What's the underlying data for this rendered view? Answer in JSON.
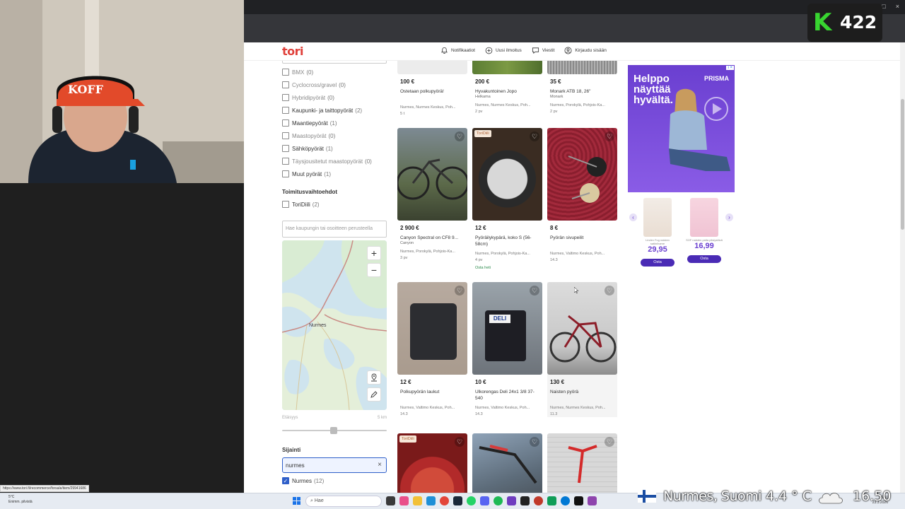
{
  "browser": {
    "window_controls": [
      "–",
      "□",
      "×"
    ]
  },
  "site": {
    "logo": "tori",
    "nav": [
      {
        "label": "Notifikaatiot",
        "icon": "bell-icon"
      },
      {
        "label": "Uusi ilmoitus",
        "icon": "plus-circle-icon"
      },
      {
        "label": "Viestit",
        "icon": "chat-icon"
      },
      {
        "label": "Kirjaudu sisään",
        "icon": "user-icon"
      }
    ]
  },
  "filters": {
    "categories": [
      {
        "label": "BMX",
        "count": "(0)",
        "disabled": true
      },
      {
        "label": "Cyclocross/gravel",
        "count": "(0)",
        "disabled": true
      },
      {
        "label": "Hybridipyörät",
        "count": "(0)",
        "disabled": true
      },
      {
        "label": "Kaupunki- ja taittopyörät",
        "count": "(2)",
        "disabled": false
      },
      {
        "label": "Maantiepyörät",
        "count": "(1)",
        "disabled": false
      },
      {
        "label": "Maastopyörät",
        "count": "(0)",
        "disabled": true
      },
      {
        "label": "Sähköpyörät",
        "count": "(1)",
        "disabled": false
      },
      {
        "label": "Täysjousitetut maastopyörät",
        "count": "(0)",
        "disabled": true
      },
      {
        "label": "Muut pyörät",
        "count": "(1)",
        "disabled": false
      }
    ],
    "delivery_title": "Toimitusvaihtoehdot",
    "delivery": {
      "label": "ToriDiili",
      "count": "(2)"
    },
    "address_placeholder": "Hae kaupungin tai osoitteen perusteella",
    "map_label": "Nurmes",
    "zoom_in": "+",
    "zoom_out": "−",
    "distance_label": "Etäisyys",
    "distance_value": "5 km",
    "distance_fraction": 0.5,
    "location_title": "Sijainti",
    "location_value": "nurmes",
    "location_clear": "×",
    "location_option": {
      "label": "Nurmes",
      "count": "(12)",
      "checked": true
    }
  },
  "listings": [
    {
      "price": "100 €",
      "title": "Ostetaan polkupyörä!",
      "brand": "",
      "meta": "Nurmes, Nurmes Keskus, Poh...",
      "age": "5 t",
      "badge": "",
      "extra": ""
    },
    {
      "price": "200 €",
      "title": "Hyvakuntoinen Jopo",
      "brand": "Helkama",
      "meta": "Nurmes, Nurmes Keskus, Poh...",
      "age": "2 pv",
      "badge": "",
      "extra": ""
    },
    {
      "price": "35 €",
      "title": "Monark ATB 18, 26\"",
      "brand": "Monark",
      "meta": "Nurmes, Porokylä, Pohjois-Ka...",
      "age": "2 pv",
      "badge": "",
      "extra": ""
    },
    {
      "price": "2 900 €",
      "title": "Canyon Spectral on CF8 9...",
      "brand": "Canyon",
      "meta": "Nurmes, Porokylä, Pohjois-Ka...",
      "age": "3 pv",
      "badge": "",
      "extra": ""
    },
    {
      "price": "12 €",
      "title": "Pyöräilykypärä, koko S (56-58cm)",
      "brand": "",
      "meta": "Nurmes, Porokylä, Pohjois-Ka...",
      "age": "4 pv",
      "badge": "ToriDiili",
      "extra": "Osta heti"
    },
    {
      "price": "8 €",
      "title": "Pyörän sivupeilit",
      "brand": "",
      "meta": "Nurmes, Valtimo Keskus, Poh...",
      "age": "14.3",
      "badge": "",
      "extra": ""
    },
    {
      "price": "12 €",
      "title": "Polkupyörän laukut",
      "brand": "",
      "meta": "Nurmes, Valtimo Keskus, Poh...",
      "age": "14.3",
      "badge": "",
      "extra": ""
    },
    {
      "price": "10 €",
      "title": "Ulkorengas Deli 24x1 3/8 37-540",
      "brand": "",
      "meta": "Nurmes, Valtimo Keskus, Poh...",
      "age": "14.3",
      "badge": "",
      "extra": ""
    },
    {
      "price": "130 €",
      "title": "Naisten pyörä",
      "brand": "",
      "meta": "Nurmes, Nurmes Keskus, Poh...",
      "age": "11.3",
      "badge": "",
      "extra": ""
    },
    {
      "price": "",
      "title": "",
      "brand": "",
      "meta": "",
      "age": "",
      "badge": "ToriDiili",
      "extra": ""
    },
    {
      "price": "",
      "title": "",
      "brand": "",
      "meta": "",
      "age": "",
      "badge": "",
      "extra": ""
    },
    {
      "price": "",
      "title": "",
      "brand": "",
      "meta": "",
      "age": "",
      "badge": "",
      "extra": ""
    }
  ],
  "ad": {
    "headline": "Helppo näyttää hyvältä.",
    "brand": "PRISMA",
    "ad_badge": "i ×",
    "products": [
      {
        "name": "Lindex Fog naisten satiinihame",
        "price": "29,95",
        "button": "Osta"
      },
      {
        "name": "SOF naisten paita pitsiystävä",
        "price": "16,99",
        "button": "Osta"
      }
    ]
  },
  "stream_overlay": {
    "k_letter": "K",
    "viewers": "422",
    "location": "Nurmes, Suomi",
    "temperature": "4.4 ° C",
    "time": "16.50"
  },
  "status_link": "https://www.tori.fi/recommerce/forsale/item/29941686",
  "taskbar": {
    "weather_temp": "5°C",
    "weather_desc": "Enimm. pilvistä",
    "search_placeholder": "Hae",
    "clock": "16.50",
    "date": "23.3.2026"
  },
  "colors": {
    "brand_red": "#e0403a",
    "ad_purple": "#6a3fd0",
    "checkbox_blue": "#2f5fc9",
    "k_green": "#38d430"
  }
}
